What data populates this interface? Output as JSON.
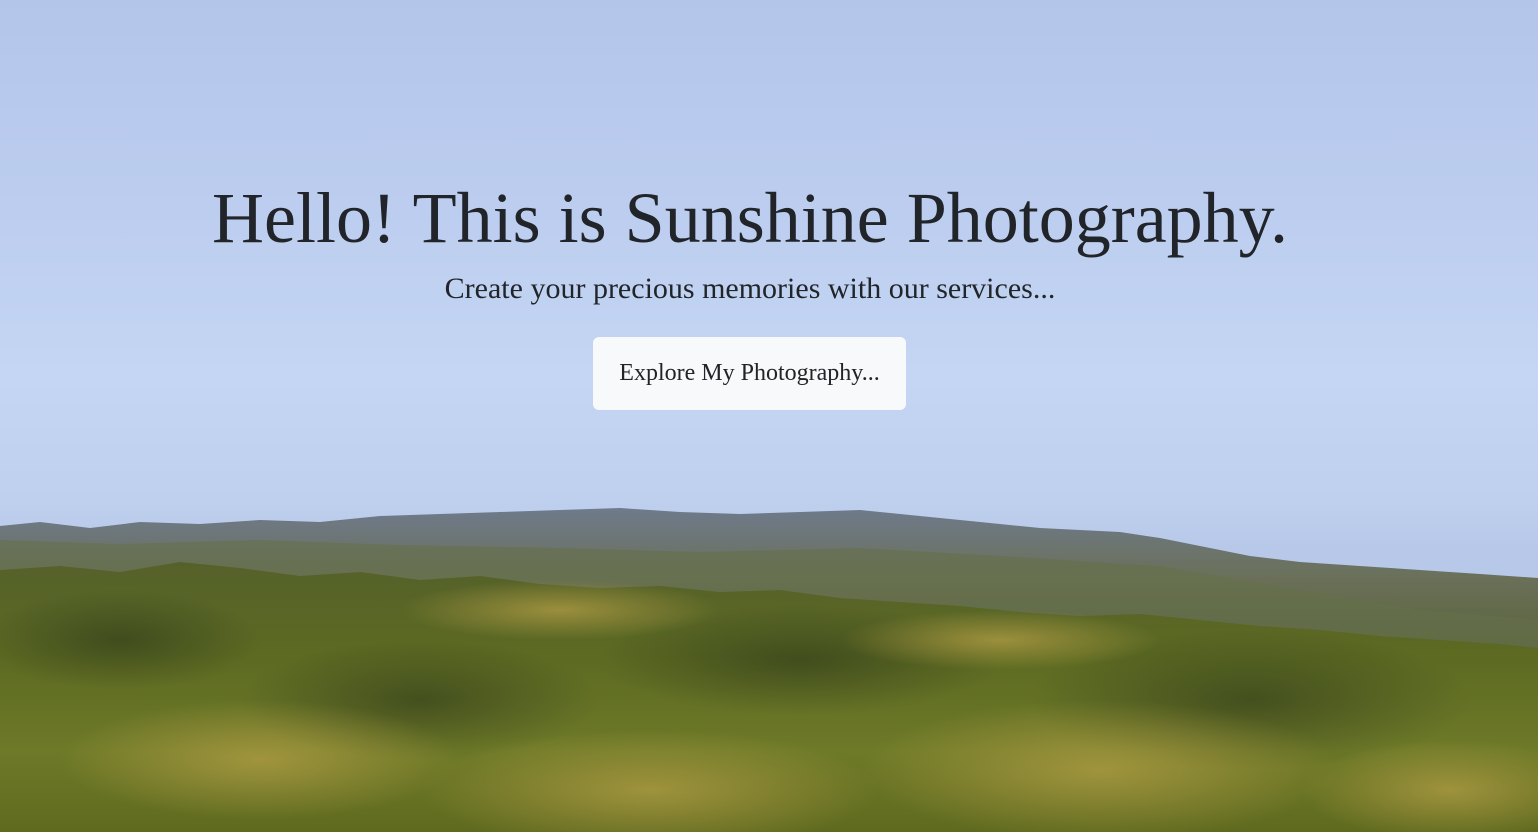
{
  "hero": {
    "title": "Hello! This is Sunshine Photography.",
    "subtitle": "Create your precious memories with our services...",
    "cta_label": "Explore My Photography..."
  },
  "colors": {
    "sky": "#bfd0ef",
    "button_bg": "#f8f9fa",
    "text": "#212529"
  }
}
